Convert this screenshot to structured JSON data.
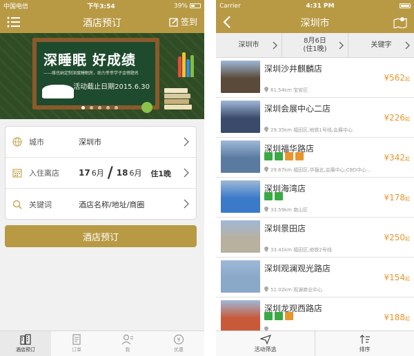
{
  "left": {
    "status": {
      "carrier": "中国电信",
      "time": "下午3:54",
      "battery": "39%"
    },
    "nav": {
      "title": "酒店预订",
      "checkin_label": "签到"
    },
    "banner": {
      "headline": "深睡眠 好成绩",
      "subline": "——维也纳定制深度睡眠房，助力莘莘学子金榜题名",
      "deadline": "活动截止日期2015.6.30",
      "slide_count": 5,
      "active_slide": 0
    },
    "form": {
      "city_label": "城市",
      "city_value": "深圳市",
      "dates_label": "入住离店",
      "checkin_day": "17",
      "checkin_month": "6月",
      "checkout_day": "18",
      "checkout_month": "6月",
      "nights": "住1晚",
      "keyword_label": "关键词",
      "keyword_placeholder": "酒店名称/地址/商圈"
    },
    "book_button": "酒店预订",
    "tabs": [
      {
        "label": "酒店预订",
        "icon": "hotel-icon",
        "active": true
      },
      {
        "label": "订单",
        "icon": "order-icon",
        "active": false
      },
      {
        "label": "我",
        "icon": "profile-icon",
        "active": false
      },
      {
        "label": "优惠",
        "icon": "coupon-icon",
        "active": false
      }
    ]
  },
  "right": {
    "status": {
      "carrier": "Carrier",
      "time": "4:31 PM"
    },
    "nav": {
      "title": "深圳市"
    },
    "filters": {
      "city": "深圳市",
      "date_line1": "8月6日",
      "date_line2": "(住1晚)",
      "keyword": "关键字"
    },
    "hotels": [
      {
        "name": "深圳沙井麒麟店",
        "price": "¥562",
        "unit": "起",
        "location": "61.54km 宝安区",
        "badges": [],
        "thumb": "#5a4a3a"
      },
      {
        "name": "深圳会展中心二店",
        "price": "¥226",
        "unit": "起",
        "location": "29.35km 福田区,地铁1号线,会展中心",
        "badges": [],
        "thumb": "#3a4a6a"
      },
      {
        "name": "深圳福华路店",
        "price": "¥342",
        "unit": "起",
        "location": "29.67km 福田区,华强北,会展中心,CBD中心...",
        "badges": [
          "#3aa845",
          "#3aa845",
          "#e8952d",
          "#e8952d"
        ],
        "thumb": "#5a7aa0"
      },
      {
        "name": "深圳海湾店",
        "price": "¥178",
        "unit": "起",
        "location": "33.59km 南山区",
        "badges": [
          "#3aa845",
          "#3aa845"
        ],
        "thumb": "#3a7ac8"
      },
      {
        "name": "深圳景田店",
        "price": "¥250",
        "unit": "起",
        "location": "33.41km 福田区,地铁2号线",
        "badges": [],
        "thumb": "#b8b0a0"
      },
      {
        "name": "深圳观澜观光路店",
        "price": "¥154",
        "unit": "起",
        "location": "51.02km 观澜商业中心",
        "badges": [],
        "thumb": "#8aa8c8"
      },
      {
        "name": "深圳龙观西路店",
        "price": "¥188",
        "unit": "起",
        "location": "",
        "badges": [
          "#3aa845",
          "#3aa845",
          "#e8952d"
        ],
        "thumb": "#c85a3a"
      }
    ],
    "bottom": {
      "filter_label": "活动筛选",
      "sort_label": "排序"
    }
  }
}
